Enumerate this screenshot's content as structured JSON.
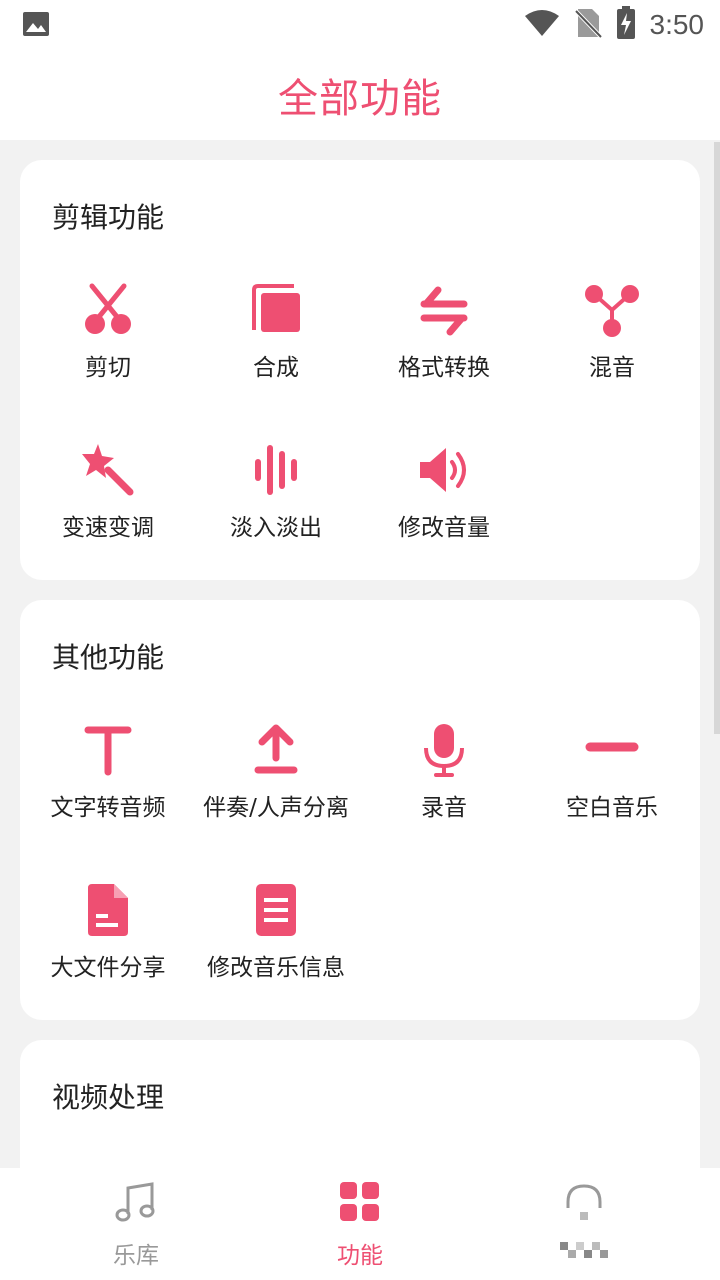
{
  "status_bar": {
    "time": "3:50",
    "icons": [
      "image-icon",
      "wifi-icon",
      "no-sim-icon",
      "battery-charging-icon"
    ]
  },
  "header": {
    "title": "全部功能"
  },
  "sections": [
    {
      "title": "剪辑功能",
      "items": [
        {
          "label": "剪切",
          "icon": "scissors-icon"
        },
        {
          "label": "合成",
          "icon": "merge-icon"
        },
        {
          "label": "格式转换",
          "icon": "convert-arrows-icon"
        },
        {
          "label": "混音",
          "icon": "mix-icon"
        },
        {
          "label": "变速变调",
          "icon": "magic-wand-icon"
        },
        {
          "label": "淡入淡出",
          "icon": "waveform-icon"
        },
        {
          "label": "修改音量",
          "icon": "volume-icon"
        }
      ]
    },
    {
      "title": "其他功能",
      "items": [
        {
          "label": "文字转音频",
          "icon": "text-icon"
        },
        {
          "label": "伴奏/人声分离",
          "icon": "upload-icon"
        },
        {
          "label": "录音",
          "icon": "microphone-icon"
        },
        {
          "label": "空白音乐",
          "icon": "minus-icon"
        },
        {
          "label": "大文件分享",
          "icon": "file-icon"
        },
        {
          "label": "修改音乐信息",
          "icon": "document-icon"
        }
      ]
    },
    {
      "title": "视频处理",
      "items": []
    }
  ],
  "tabbar": {
    "tabs": [
      {
        "label": "乐库",
        "icon": "music-note-icon",
        "active": false
      },
      {
        "label": "功能",
        "icon": "grid-icon",
        "active": true
      },
      {
        "label": "",
        "icon": "headset-icon",
        "active": false
      }
    ]
  },
  "colors": {
    "accent": "#ee4f72",
    "background": "#f2f2f2",
    "inactive": "#999999"
  }
}
